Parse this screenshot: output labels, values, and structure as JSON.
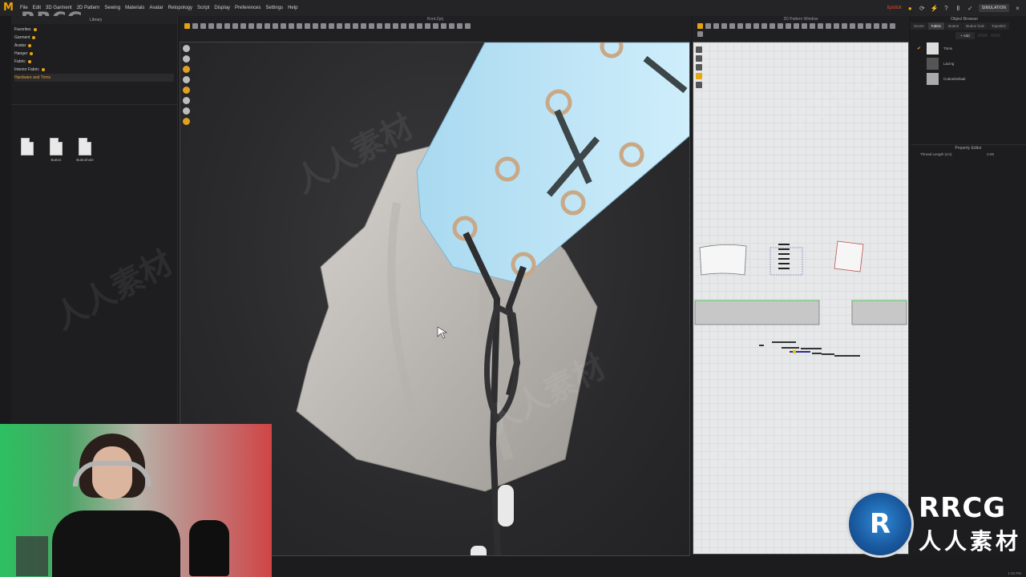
{
  "app": {
    "logo": "M",
    "menu": [
      "File",
      "Edit",
      "3D Garment",
      "2D Pattern",
      "Sewing",
      "Materials",
      "Avatar",
      "Retopology",
      "Script",
      "Display",
      "Preferences",
      "Settings",
      "Help"
    ],
    "project_name": "lipstick",
    "simulation_label": "SIMULATION",
    "accent_color": "#e6a20f"
  },
  "watermark": {
    "corner_text": "RRCG",
    "logo_badge": "R",
    "logo_en": "RRCG",
    "logo_cn": "人人素材",
    "ghost_cn": "人人素材",
    "ghost_en": "RRCG"
  },
  "library": {
    "title": "Library",
    "tree": [
      {
        "label": "Favorites",
        "active": false
      },
      {
        "label": "Garment",
        "active": false
      },
      {
        "label": "Avatar",
        "active": false
      },
      {
        "label": "Hanger",
        "active": false
      },
      {
        "label": "Fabric",
        "active": false
      },
      {
        "label": "Interior Fabric",
        "active": false
      },
      {
        "label": "Hardware and Trims",
        "active": true
      }
    ],
    "files": [
      {
        "label": ""
      },
      {
        "label": "Button"
      },
      {
        "label": "Buttonhole"
      }
    ]
  },
  "viewport3d": {
    "title": "Knot.Zprj"
  },
  "pattern2d": {
    "title": "2D Pattern Window"
  },
  "object_browser": {
    "title": "Object Browser",
    "tabs": [
      "Scene",
      "Fabric",
      "Button",
      "Button hole",
      "Topstitch"
    ],
    "active_tab": "Fabric",
    "add_label": "+ Add",
    "items": [
      {
        "name": "Trims",
        "checked": true
      },
      {
        "name": "Lacing",
        "checked": false
      },
      {
        "name": "CottonDefault",
        "checked": false
      }
    ]
  },
  "property_editor": {
    "title": "Property Editor",
    "rows": [
      {
        "label": "Thread Length (cm)",
        "value": "0.00"
      }
    ]
  },
  "status": {
    "time": "1:25 PM"
  }
}
